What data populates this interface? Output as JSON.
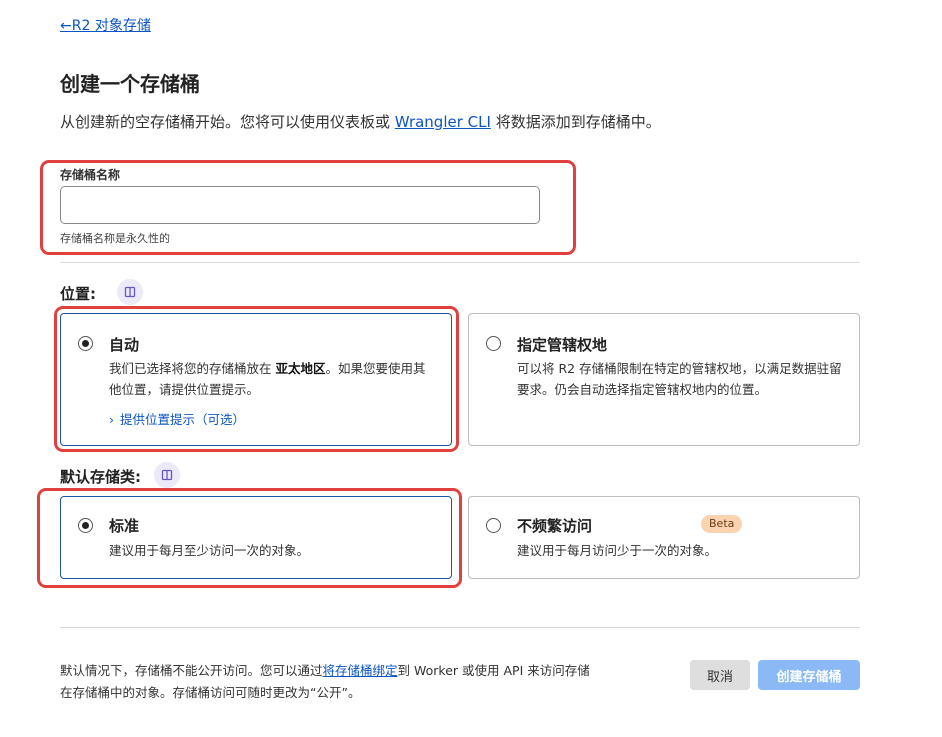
{
  "nav": {
    "back_arrow": "←",
    "back_label": "R2 对象存储"
  },
  "page": {
    "title": "创建一个存储桶",
    "intro_prefix": "从创建新的空存储桶开始。您将可以使用仪表板或 ",
    "intro_link": "Wrangler CLI",
    "intro_suffix": " 将数据添加到存储桶中。"
  },
  "bucket_name": {
    "label": "存储桶名称",
    "value": "",
    "placeholder": "",
    "hint": "存储桶名称是永久性的"
  },
  "location": {
    "label": "位置:",
    "info_icon": "book-icon",
    "options": [
      {
        "title": "自动",
        "selected": true,
        "desc_prefix": "我们已选择将您的存储桶放在 ",
        "desc_bold": "亚太地区",
        "desc_suffix": "。如果您要使用其他位置，请提供位置提示。",
        "hint_chevron": "›",
        "hint_link": "提供位置提示（可选）"
      },
      {
        "title": "指定管辖权地",
        "selected": false,
        "desc": "可以将 R2 存储桶限制在特定的管辖权地，以满足数据驻留要求。仍会自动选择指定管辖权地内的位置。"
      }
    ]
  },
  "storage_class": {
    "label": "默认存储类:",
    "info_icon": "book-icon",
    "options": [
      {
        "title": "标准",
        "selected": true,
        "desc": "建议用于每月至少访问一次的对象。"
      },
      {
        "title": "不频繁访问",
        "selected": false,
        "badge": "Beta",
        "desc": "建议用于每月访问少于一次的对象。"
      }
    ]
  },
  "footer": {
    "text_prefix": "默认情况下，存储桶不能公开访问。您可以通过",
    "text_link": "将存储桶绑定",
    "text_suffix": "到 Worker 或使用 API 来访问存储在存储桶中的对象。存储桶访问可随时更改为“公开”。",
    "cancel_label": "取消",
    "create_label": "创建存储桶"
  },
  "colors": {
    "accent": "#0b55c4",
    "highlight": "#e0413f",
    "primary_button": "#8ab9f5",
    "beta_badge": "#fcd3b0"
  }
}
